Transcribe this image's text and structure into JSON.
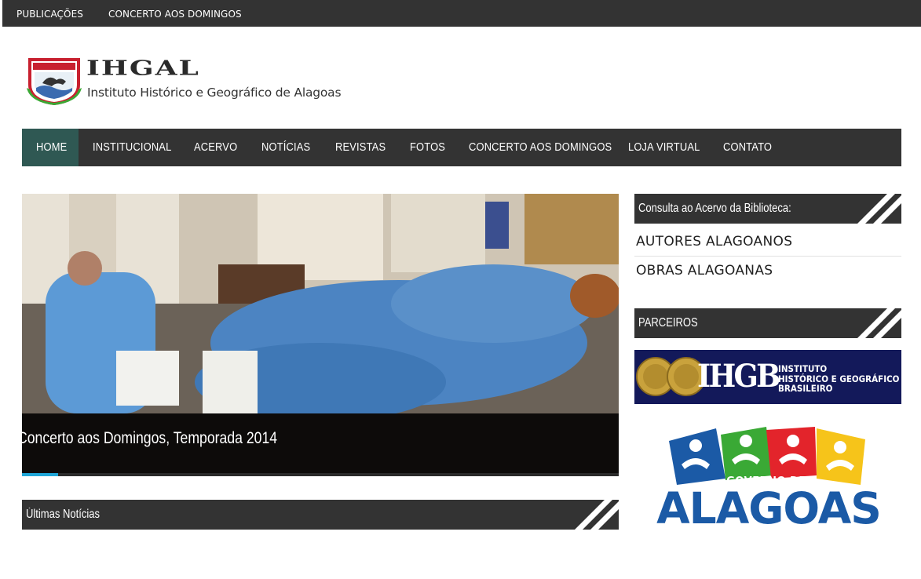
{
  "topbar": {
    "links": [
      "PUBLICAÇÕES",
      "CONCERTO AOS DOMINGOS"
    ]
  },
  "logo": {
    "title": "IHGAL",
    "subtitle": "Instituto Histórico e Geográfico de Alagoas"
  },
  "nav": {
    "items": [
      "HOME",
      "INSTITUCIONAL",
      "ACERVO",
      "NOTÍCIAS",
      "REVISTAS",
      "FOTOS",
      "CONCERTO AOS DOMINGOS",
      "LOJA VIRTUAL",
      "CONTATO"
    ],
    "active": "HOME"
  },
  "slider": {
    "caption": "Concerto aos Domingos, Temporada 2014",
    "progress": 0.06
  },
  "main": {
    "latest_news_title": "Últimas Notícias"
  },
  "sidebar": {
    "library_title": "Consulta ao Acervo da Biblioteca:",
    "library_links": [
      "AUTORES ALAGOANOS",
      "OBRAS ALAGOANAS"
    ],
    "partners_title": "PARCEIROS",
    "partners": {
      "ihgb": {
        "letters": "IHGB",
        "name_lines": [
          "INSTITUTO",
          "HISTÓRICO E GEOGRÁFICO",
          "BRASILEIRO"
        ]
      },
      "governo": {
        "line1": "GOVERNO DE",
        "line2": "ALAGOAS"
      }
    }
  },
  "colors": {
    "dark_bar": "#333333",
    "nav_active": "#2f5853",
    "accent_blue": "#1fa6d8",
    "ihgb_navy": "#13195a",
    "gov_blue": "#1b5aa6",
    "gov_green": "#3aa935",
    "gov_red": "#e3242b",
    "gov_yellow": "#f6c41a"
  },
  "icons": {
    "crest": "ihgal-crest-icon",
    "stripes": "diagonal-stripes-icon"
  }
}
